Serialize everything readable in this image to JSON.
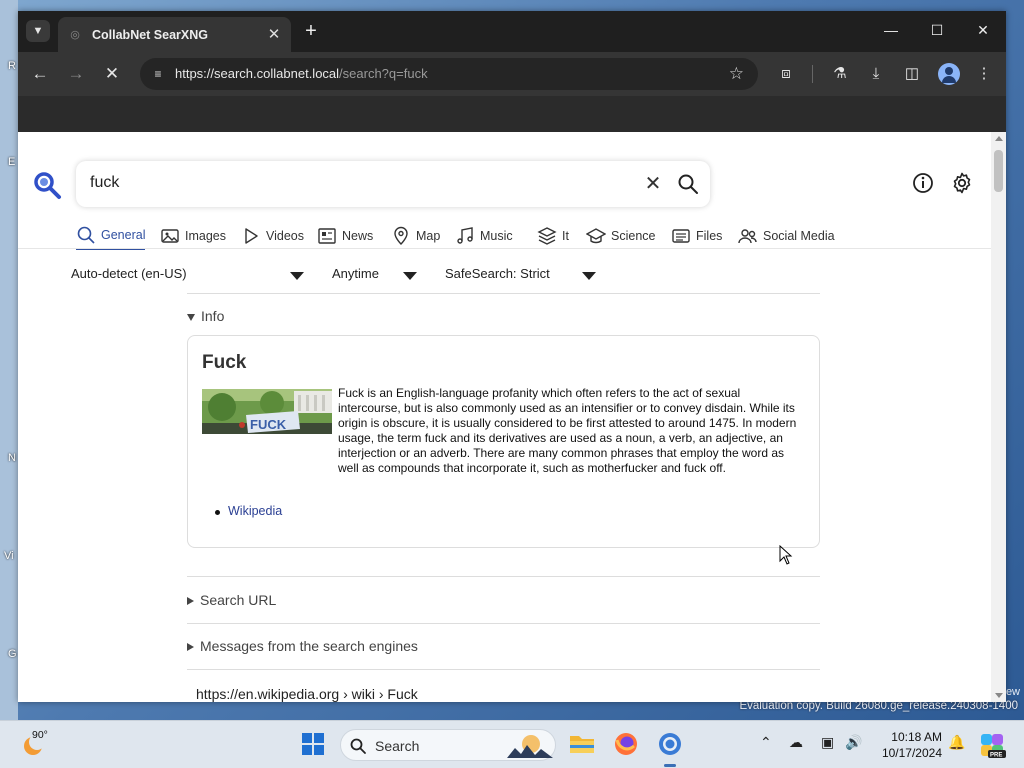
{
  "desktop": {
    "watermark": "Evaluation copy. Build 26080.ge_release.240308-1400",
    "watermark_tail": "ew",
    "edge_letters": [
      "R",
      "E",
      "N",
      "Vi",
      "G"
    ]
  },
  "browser": {
    "tab_title": "CollabNet SearXNG",
    "url_host": "https://search.collabnet.local",
    "url_path": "/search?q=fuck"
  },
  "search": {
    "query": "fuck"
  },
  "categories": [
    {
      "label": "General",
      "icon": "search-icon",
      "active": true
    },
    {
      "label": "Images",
      "icon": "image-icon"
    },
    {
      "label": "Videos",
      "icon": "play-icon"
    },
    {
      "label": "News",
      "icon": "newspaper-icon"
    },
    {
      "label": "Map",
      "icon": "map-pin-icon"
    },
    {
      "label": "Music",
      "icon": "music-note-icon"
    },
    {
      "label": "It",
      "icon": "layers-icon"
    },
    {
      "label": "Science",
      "icon": "school-icon"
    },
    {
      "label": "Files",
      "icon": "files-icon"
    },
    {
      "label": "Social Media",
      "icon": "people-icon"
    }
  ],
  "filters": {
    "language": "Auto-detect (en-US)",
    "time": "Anytime",
    "safesearch": "SafeSearch: Strict"
  },
  "infobox": {
    "section_label": "Info",
    "title": "Fuck",
    "image_text": "FUCK",
    "description": "Fuck is an English-language profanity which often refers to the act of sexual intercourse, but is also commonly used as an intensifier or to convey disdain. While its origin is obscure, it is usually considered to be first attested to around 1475. In modern usage, the term fuck and its derivatives are used as a noun, a verb, an adjective, an interjection or an adverb. There are many common phrases that employ the word as well as compounds that incorporate it, such as motherfucker and fuck off.",
    "link": "Wikipedia"
  },
  "sections": {
    "search_url": "Search URL",
    "messages": "Messages from the search engines"
  },
  "result": {
    "url": "https://en.wikipedia.org  › wiki › Fuck"
  },
  "taskbar": {
    "temperature": "90°",
    "search_placeholder": "Search",
    "time": "10:18 AM",
    "date": "10/17/2024",
    "copilot_badge": "PRE"
  },
  "colors": {
    "accent": "#3050a0",
    "link": "#2a3f93"
  }
}
